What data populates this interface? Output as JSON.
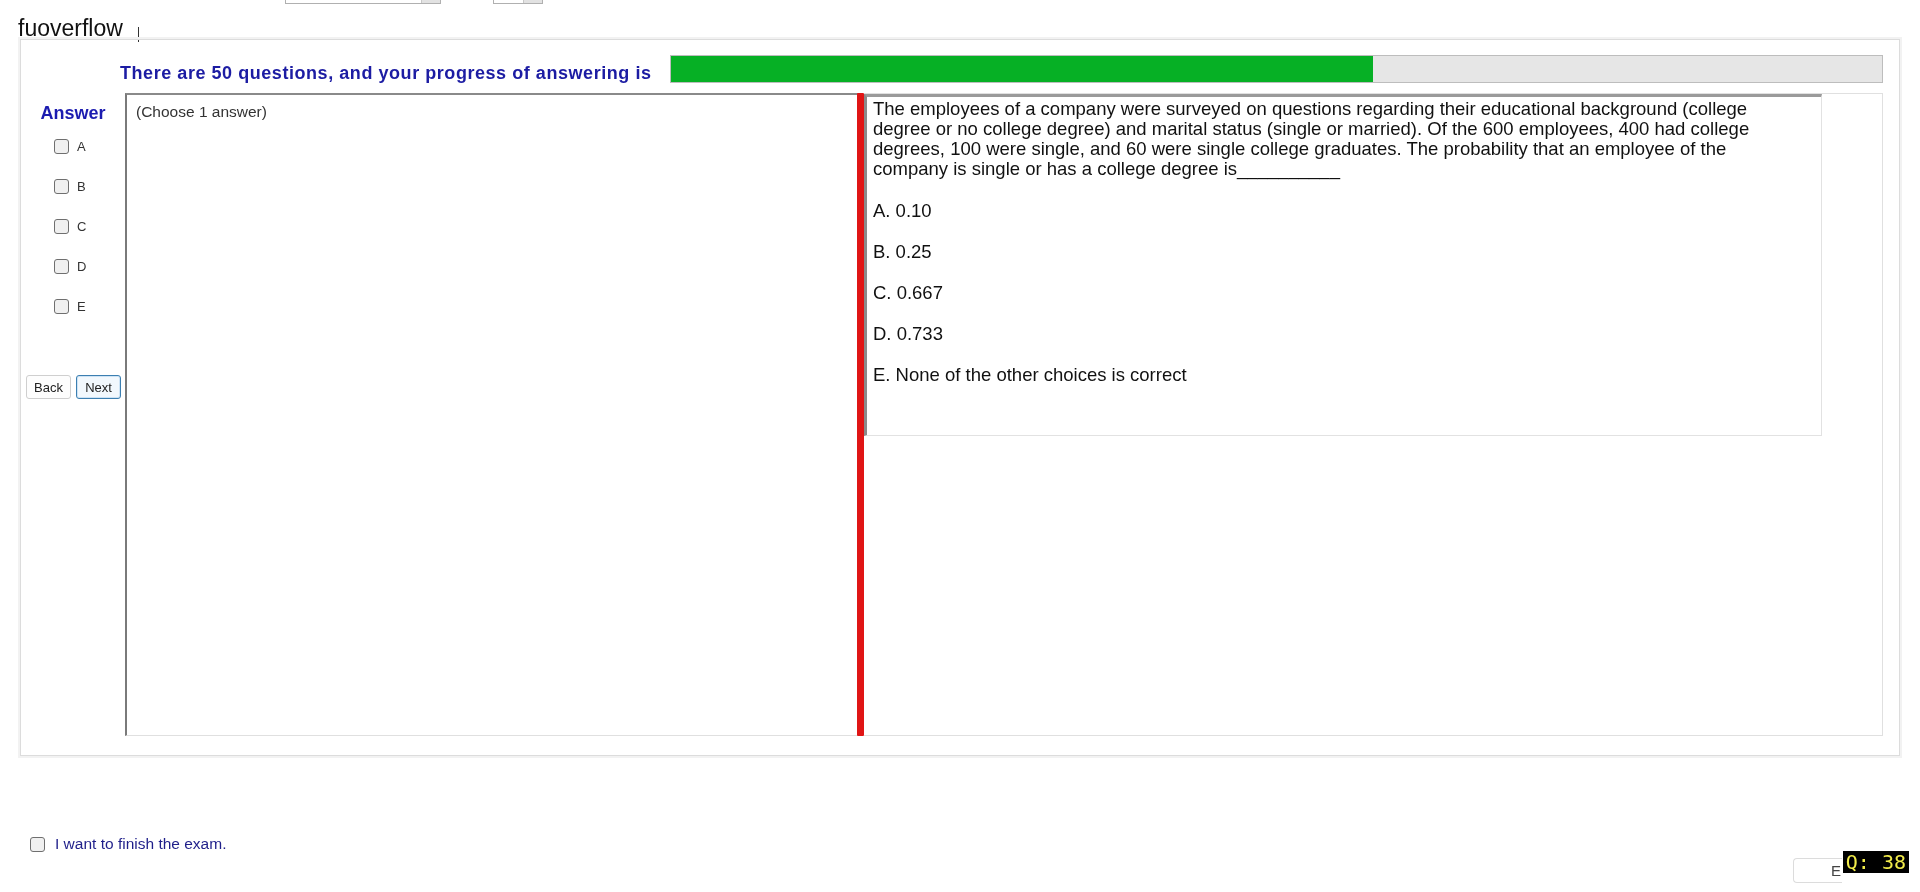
{
  "user_label": "fuoverflow",
  "progress": {
    "label": "There are 50 questions, and your progress of answering is",
    "level": 0.58
  },
  "answer_panel": {
    "title": "Answer",
    "choices": [
      {
        "label": "A",
        "checked": false
      },
      {
        "label": "B",
        "checked": false
      },
      {
        "label": "C",
        "checked": false
      },
      {
        "label": "D",
        "checked": false
      },
      {
        "label": "E",
        "checked": false
      }
    ]
  },
  "nav_buttons": [
    {
      "label": "Back",
      "focused": false
    },
    {
      "label": "Next",
      "focused": true
    }
  ],
  "answer_box": {
    "text": "(Choose 1 answer)"
  },
  "question": {
    "text": "The employees of a company were surveyed on questions regarding their educational background (college degree or no college degree) and marital status (single or married). Of the 600 employees, 400 had college degrees, 100 were single, and 60 were single college graduates. The probability that an employee of the company is single or has a college degree is__________",
    "options": [
      "A. 0.10",
      "B. 0.25",
      "C. 0.667",
      "D. 0.733",
      "E. None of the other choices is correct"
    ]
  },
  "finish": {
    "label": "I want to finish the exam.",
    "checked": false
  },
  "bottom_button": {
    "label": "E"
  },
  "question_number": "Q: 38"
}
